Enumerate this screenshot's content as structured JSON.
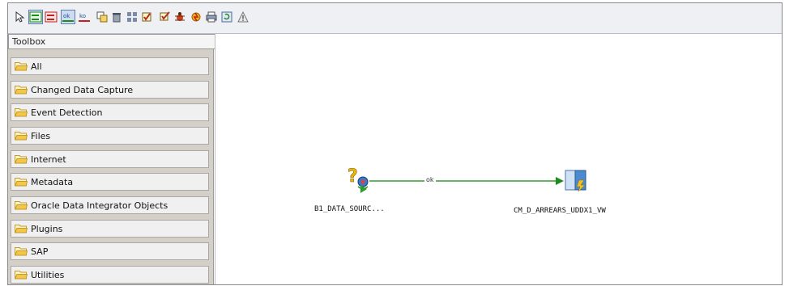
{
  "toolbox": {
    "title": "Toolbox",
    "items": [
      {
        "label": "All"
      },
      {
        "label": "Changed Data Capture"
      },
      {
        "label": "Event Detection"
      },
      {
        "label": "Files"
      },
      {
        "label": "Internet"
      },
      {
        "label": "Metadata"
      },
      {
        "label": "Oracle Data Integrator Objects"
      },
      {
        "label": "Plugins"
      },
      {
        "label": "SAP"
      },
      {
        "label": "Utilities"
      }
    ]
  },
  "toolbar": {
    "icons": [
      "select-icon",
      "next-step-on-success-icon",
      "next-step-on-failure-icon",
      "ok-link-icon",
      "ko-link-icon",
      "duplicate-icon",
      "delete-icon",
      "align-icon",
      "validate-icon",
      "validate-all-icon",
      "debug-icon",
      "execute-icon",
      "print-icon",
      "refresh-icon",
      "warning-icon"
    ],
    "ok_label": "ok",
    "ko_label": "ko"
  },
  "canvas": {
    "nodes": [
      {
        "label": "B1_DATA_SOURC...",
        "icon": "variable-question-icon"
      },
      {
        "label": "CM_D_ARREARS_UDDX1_VW",
        "icon": "interface-icon"
      }
    ],
    "link_label": "ok",
    "colors": {
      "link": "#2e9e2e",
      "folder": "#f3c84a",
      "selected": "#5b7fb5"
    }
  }
}
